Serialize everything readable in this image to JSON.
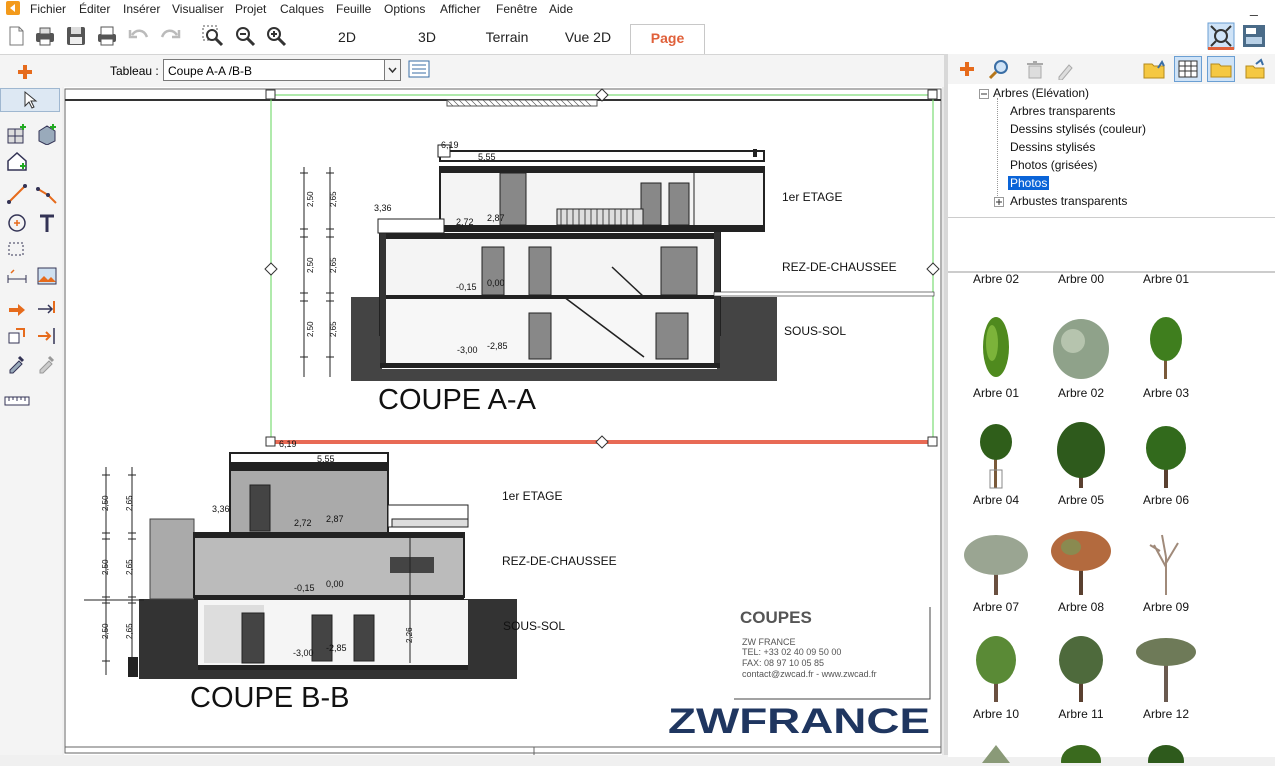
{
  "menu": [
    "Fichier",
    "Éditer",
    "Insérer",
    "Visualiser",
    "Projet",
    "Calques",
    "Feuille",
    "Options",
    "Afficher",
    "Fenêtre",
    "Aide"
  ],
  "window": {
    "minimize": "_"
  },
  "toolbar": {
    "icons": [
      "new-file-icon",
      "print-icon",
      "save-icon",
      "print-preview-icon",
      "undo-icon",
      "redo-icon",
      "zoom-window-icon",
      "zoom-extents-icon",
      "zoom-in-icon"
    ]
  },
  "view_tabs": [
    "2D",
    "3D",
    "Terrain",
    "Vue 2D",
    "Page"
  ],
  "sheet": {
    "label": "Tableau :",
    "value": "Coupe A-A /B-B"
  },
  "tree": {
    "root": "Arbres (Elévation)",
    "items": [
      "Arbres transparents",
      "Dessins stylisés (couleur)",
      "Dessins stylisés",
      "Photos (grisées)",
      "Photos",
      "Arbustes transparents"
    ],
    "selected": "Photos"
  },
  "gallery": {
    "partial_row": [
      "Arbre  02",
      "Arbre 00",
      "Arbre 01"
    ],
    "rows": [
      [
        "Arbre 01",
        "Arbre 02",
        "Arbre 03"
      ],
      [
        "Arbre 04",
        "Arbre 05",
        "Arbre 06"
      ],
      [
        "Arbre 07",
        "Arbre 08",
        "Arbre 09"
      ],
      [
        "Arbre 10",
        "Arbre 11",
        "Arbre 12"
      ]
    ]
  },
  "drawing": {
    "section_a": {
      "title": "COUPE  A-A",
      "levels": [
        "1er ETAGE",
        "REZ-DE-CHAUSSEE",
        "SOUS-SOL"
      ],
      "elevations": [
        "6,19",
        "5,55",
        "3,36",
        "2,72",
        "2,87",
        "-0,15",
        "0,00",
        "-3,00",
        "-2,85"
      ],
      "dims": [
        "2,50",
        "2,65",
        "2,50",
        "2,65",
        "2,50",
        "2,65"
      ]
    },
    "section_b": {
      "title": "COUPE B-B",
      "levels": [
        "1er ETAGE",
        "REZ-DE-CHAUSSEE",
        "SOUS-SOL"
      ],
      "elevations": [
        "6,19",
        "5,55",
        "3,36",
        "2,72",
        "2,87",
        "-0,15",
        "0,00",
        "-3,00",
        "-2,85"
      ],
      "dims": [
        "2,50",
        "2,65",
        "2,50",
        "2,65",
        "2,50",
        "2,65",
        "2,26"
      ]
    },
    "cartouche": {
      "title": "COUPES",
      "lines": [
        "ZW FRANCE",
        "TEL: +33 02 40 09 50 00",
        "FAX: 08 97 10 05 85",
        "contact@zwcad.fr -  www.zwcad.fr"
      ],
      "logo": "ZWFRANCE"
    }
  },
  "colors": {
    "accent": "#e0603a",
    "selection": "#0a64d8",
    "viewport_frame": "#7bdc74",
    "viewport_selected_edge": "#e86a55"
  }
}
